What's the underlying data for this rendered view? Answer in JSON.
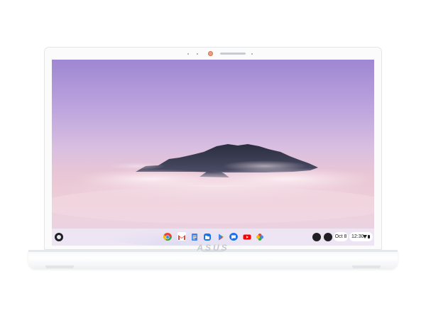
{
  "device": {
    "brand_logo": "ASUS"
  },
  "wallpaper": {
    "description_name": "mountain-above-clouds"
  },
  "shelf": {
    "launcher_icon": "launcher-icon",
    "apps": [
      {
        "name": "chrome-icon",
        "colors": [
          "#ea4335",
          "#fbbc04",
          "#34a853",
          "#4285f4"
        ]
      },
      {
        "name": "gmail-icon",
        "colors": [
          "#ea4335",
          "#ffffff"
        ]
      },
      {
        "name": "docs-icon",
        "colors": [
          "#4285f4",
          "#ffffff"
        ]
      },
      {
        "name": "files-icon",
        "colors": [
          "#1a73e8",
          "#ffffff"
        ]
      },
      {
        "name": "play-store-icon",
        "colors": [
          "#34a853",
          "#4285f4",
          "#fbbc04",
          "#ea4335"
        ]
      },
      {
        "name": "messages-icon",
        "colors": [
          "#1a73e8",
          "#ffffff"
        ]
      },
      {
        "name": "youtube-icon",
        "colors": [
          "#ff0000",
          "#ffffff"
        ]
      },
      {
        "name": "photos-icon",
        "colors": [
          "#ea4335",
          "#fbbc04",
          "#34a853",
          "#4285f4"
        ]
      }
    ],
    "tray": {
      "date": "Oct 8",
      "time": "12:30"
    }
  }
}
